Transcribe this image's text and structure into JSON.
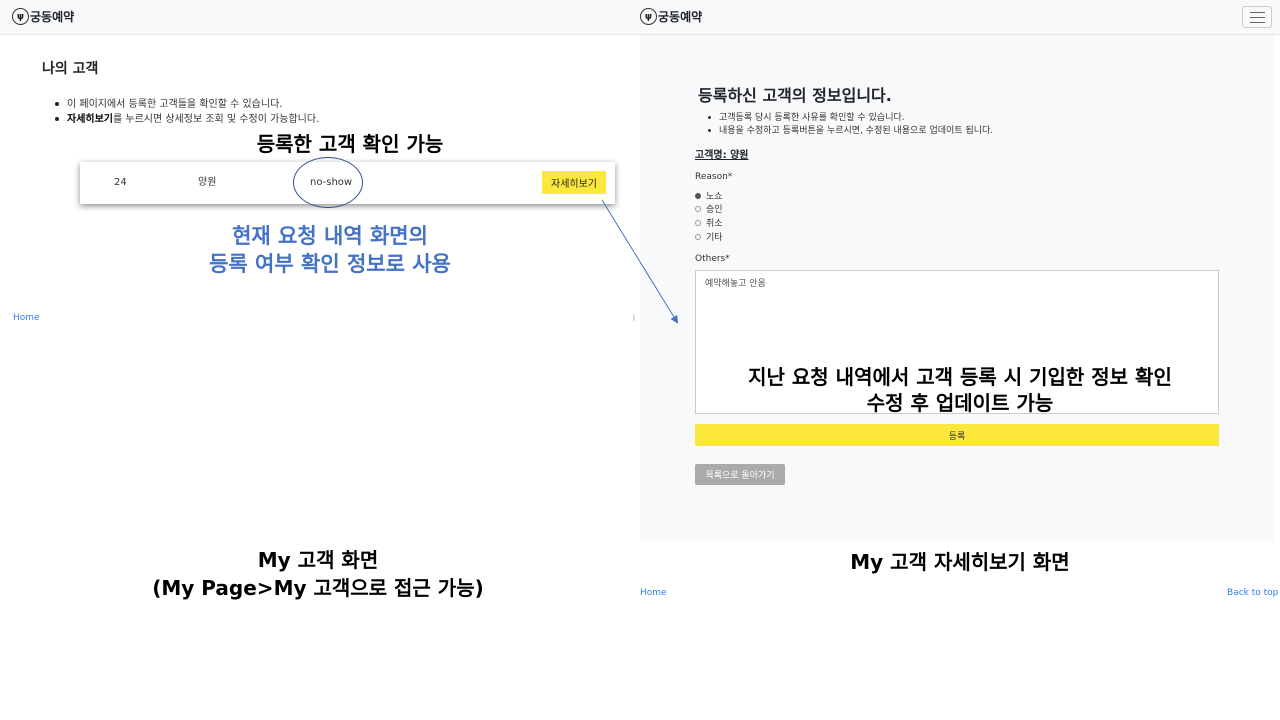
{
  "left": {
    "brand": "궁동예약",
    "logo_icon": "fork-knife-icon",
    "title": "나의 고객",
    "bullets": [
      {
        "bold": "",
        "text": "이 페이지에서 등록한 고객들을 확인할 수 있습니다."
      },
      {
        "bold": "자세히보기",
        "text": "를 누르시면 상세정보 조회 및 수정이 가능합니다."
      }
    ],
    "row": {
      "id": "24",
      "name": "양원",
      "status": "no-show",
      "detail_button": "자세히보기"
    },
    "footer_home": "Home"
  },
  "right": {
    "brand": "궁동예약",
    "logo_icon": "fork-knife-icon",
    "menu_icon": "hamburger-menu-icon",
    "title": "등록하신 고객의 정보입니다.",
    "bullets": [
      "고객등록 당시 등록한 사유를 확인할 수 있습니다.",
      "내용을 수정하고 등록버튼을 누르시면, 수정된 내용으로 업데이트 됩니다."
    ],
    "customer_name": "고객명: 양원",
    "reason_label": "Reason*",
    "reason_options": [
      "노쇼",
      "승인",
      "취소",
      "기타"
    ],
    "reason_selected": "노쇼",
    "others_label": "Others*",
    "others_value": "예약해놓고 안옴",
    "submit_button": "등록",
    "back_button": "목록으로 돌아가기",
    "footer_home": "Home",
    "footer_top": "Back to top"
  },
  "annotations": {
    "left_top": "등록한 고객 확인 가능",
    "left_blue_line1": "현재 요청 내역 화면의",
    "left_blue_line2": "등록 여부 확인 정보로 사용",
    "left_caption_line1": "My 고객 화면",
    "left_caption_line2": "(My Page>My 고객으로 접근 가능)",
    "right_overlay_line1": "지난 요청 내역에서 고객 등록 시 기입한 정보 확인",
    "right_overlay_line2": "수정 후 업데이트 가능",
    "right_caption": "My 고객 자세히보기 화면"
  },
  "colors": {
    "accent_yellow": "#fce83a",
    "annotation_blue": "#4472c4",
    "link_blue": "#2f80ed",
    "navbar_bg": "#f8f9fa",
    "back_button_gray": "#aaaaaa"
  }
}
